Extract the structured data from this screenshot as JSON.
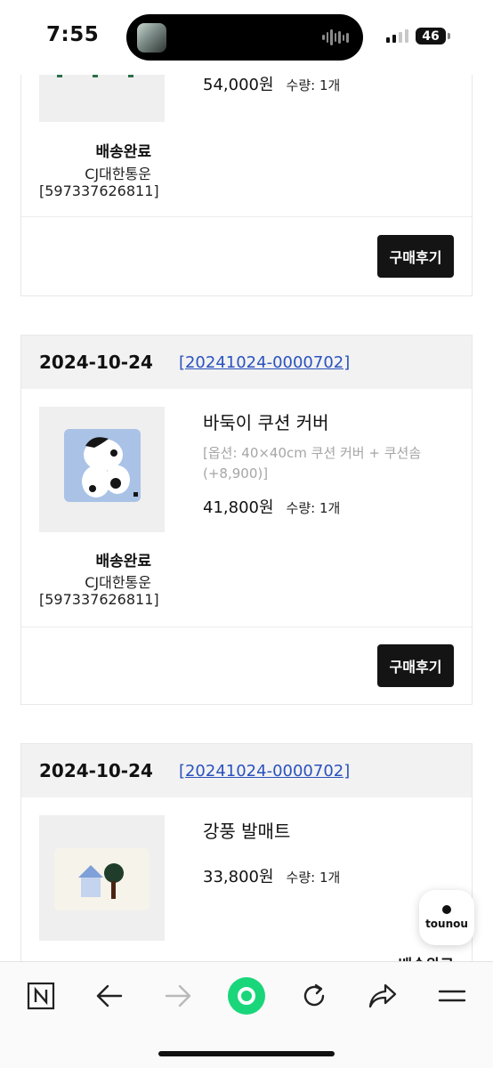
{
  "status_bar": {
    "time": "7:55",
    "battery": "46"
  },
  "orders": [
    {
      "product": {
        "price": "54,000원",
        "qty": "수량: 1개"
      },
      "shipping": {
        "status": "배송완료",
        "courier": "CJ대한통운",
        "tracking": "[597337626811]"
      },
      "review_label": "구매후기"
    },
    {
      "date": "2024-10-24",
      "order_no": "[20241024-0000702]",
      "product": {
        "name": "바둑이 쿠션 커버",
        "option": "[옵션: 40×40cm 쿠션 커버 + 쿠션솜 (+8,900)]",
        "price": "41,800원",
        "qty": "수량: 1개"
      },
      "shipping": {
        "status": "배송완료",
        "courier": "CJ대한통운",
        "tracking": "[597337626811]"
      },
      "review_label": "구매후기"
    },
    {
      "date": "2024-10-24",
      "order_no": "[20241024-0000702]",
      "product": {
        "name": "강풍 발매트",
        "price": "33,800원",
        "qty": "수량: 1개"
      },
      "shipping": {
        "status": "배송완료"
      }
    }
  ],
  "floating_logo": {
    "label": "tounou"
  },
  "browser_nav": {
    "icons": [
      "naver-n-icon",
      "back-arrow-icon",
      "forward-arrow-icon",
      "green-circle-home-icon",
      "refresh-icon",
      "share-icon",
      "menu-icon"
    ]
  },
  "colors": {
    "accent_green": "#19d67a",
    "link_blue": "#2a52be",
    "button_dark": "#141414"
  }
}
